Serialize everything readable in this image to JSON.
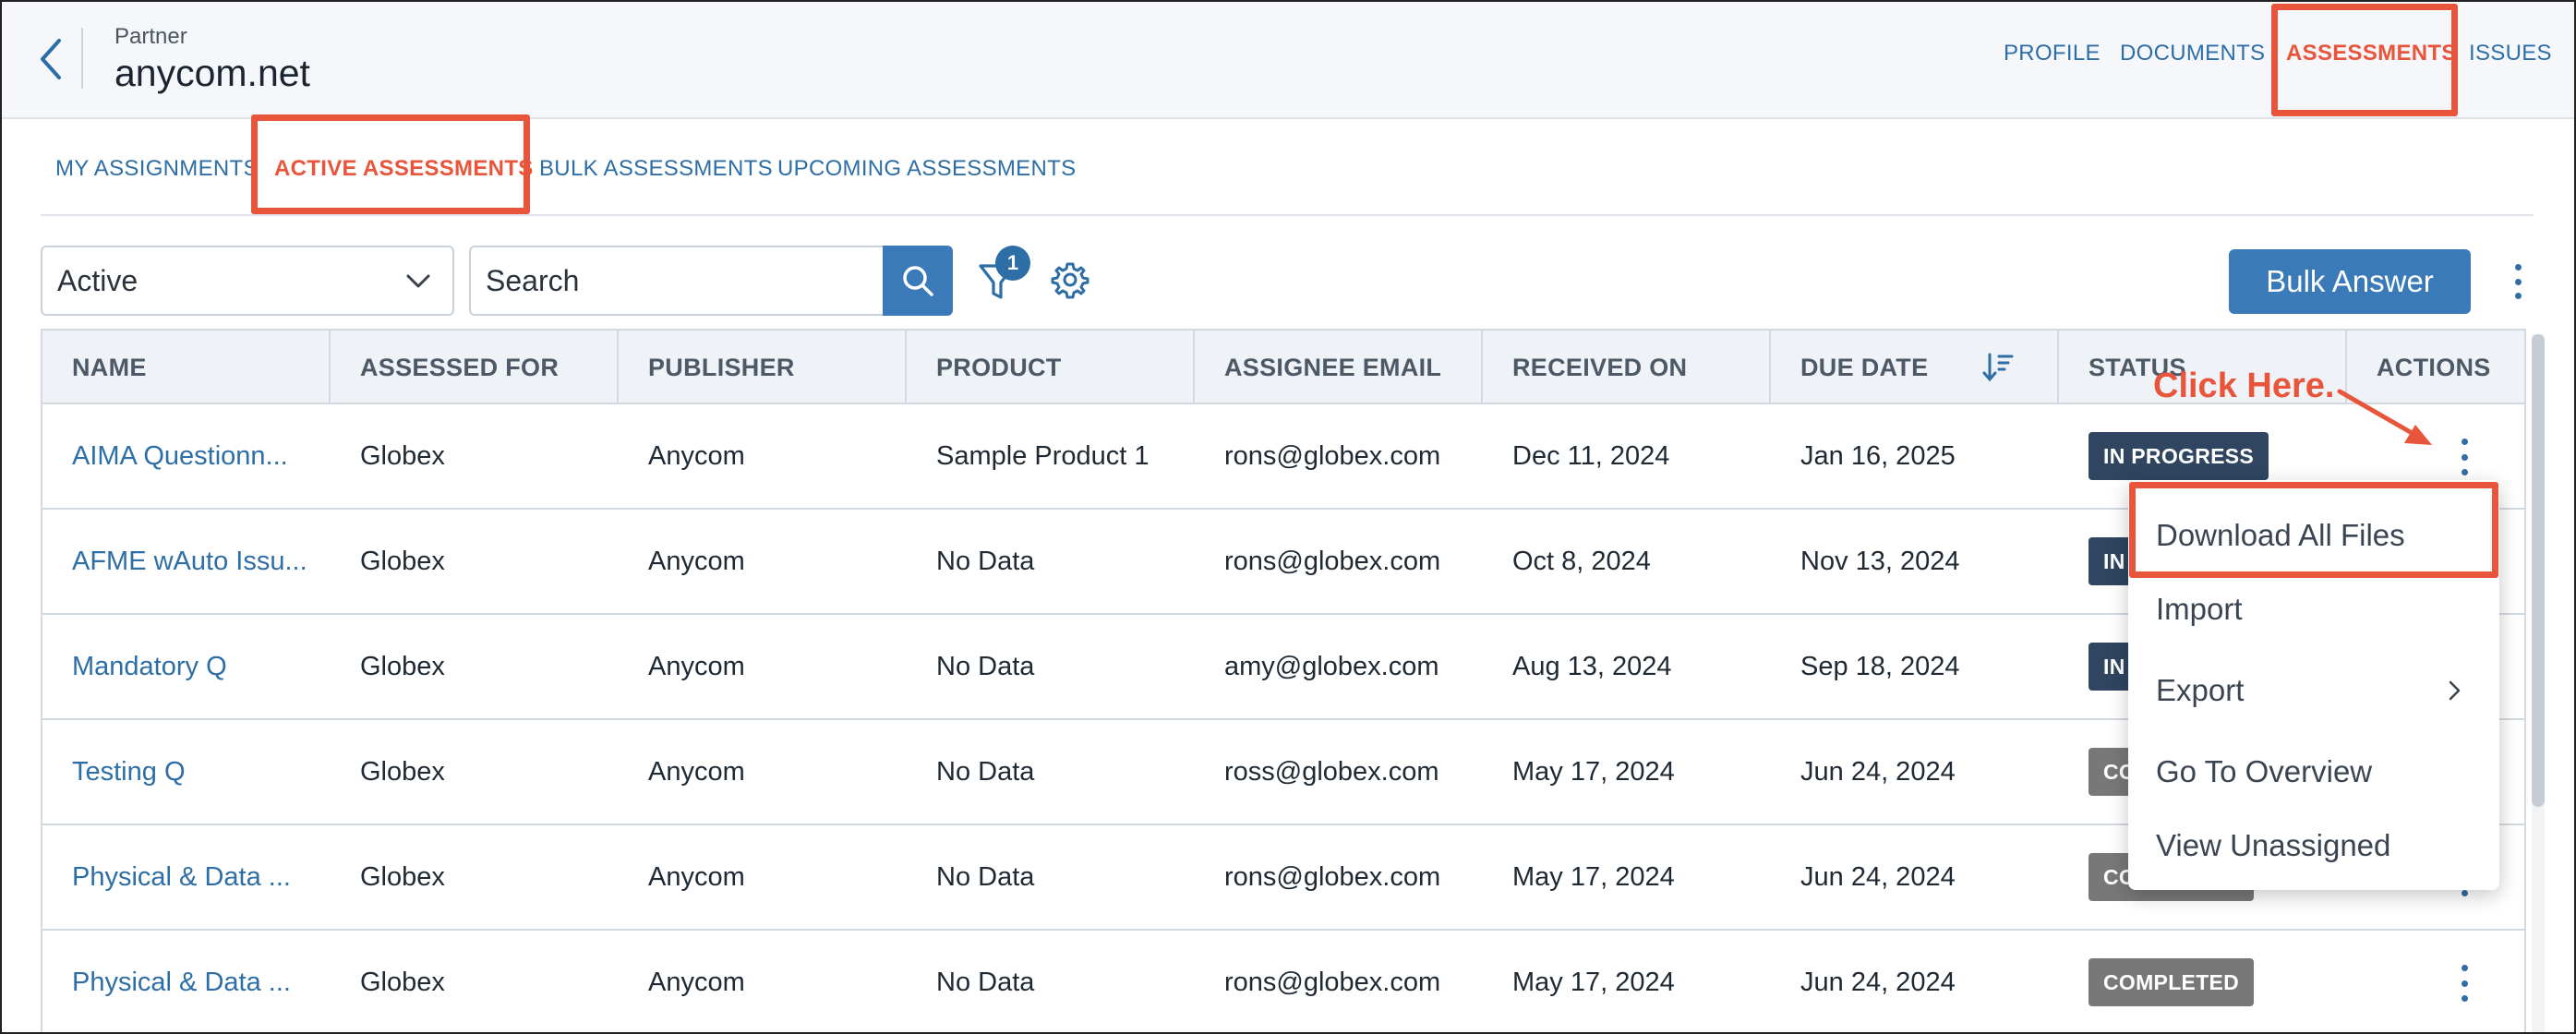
{
  "header": {
    "partner_label": "Partner",
    "partner_name": "anycom.net",
    "nav": [
      "PROFILE",
      "DOCUMENTS",
      "ASSESSMENTS",
      "ISSUES"
    ]
  },
  "subtabs": [
    "MY ASSIGNMENTS",
    "ACTIVE ASSESSMENTS",
    "BULK ASSESSMENTS",
    "UPCOMING ASSESSMENTS"
  ],
  "toolbar": {
    "status_value": "Active",
    "search_placeholder": "Search",
    "filter_count": "1",
    "bulk_answer_label": "Bulk Answer"
  },
  "table": {
    "columns": [
      "NAME",
      "ASSESSED FOR",
      "PUBLISHER",
      "PRODUCT",
      "ASSIGNEE EMAIL",
      "RECEIVED ON",
      "DUE DATE",
      "STATUS",
      "ACTIONS"
    ],
    "rows": [
      {
        "name": "AIMA Questionn...",
        "assessed_for": "Globex",
        "publisher": "Anycom",
        "product": "Sample Product 1",
        "email": "rons@globex.com",
        "received": "Dec 11, 2024",
        "due": "Jan 16, 2025",
        "status": "IN PROGRESS"
      },
      {
        "name": "AFME wAuto Issu...",
        "assessed_for": "Globex",
        "publisher": "Anycom",
        "product": "No Data",
        "email": "rons@globex.com",
        "received": "Oct 8, 2024",
        "due": "Nov 13, 2024",
        "status": "IN PROGRESS"
      },
      {
        "name": "Mandatory Q",
        "assessed_for": "Globex",
        "publisher": "Anycom",
        "product": "No Data",
        "email": "amy@globex.com",
        "received": "Aug 13, 2024",
        "due": "Sep 18, 2024",
        "status": "IN PROGRESS"
      },
      {
        "name": "Testing Q",
        "assessed_for": "Globex",
        "publisher": "Anycom",
        "product": "No Data",
        "email": "ross@globex.com",
        "received": "May 17, 2024",
        "due": "Jun 24, 2024",
        "status": "COMPLETED"
      },
      {
        "name": "Physical & Data ...",
        "assessed_for": "Globex",
        "publisher": "Anycom",
        "product": "No Data",
        "email": "rons@globex.com",
        "received": "May 17, 2024",
        "due": "Jun 24, 2024",
        "status": "COMPLETED"
      },
      {
        "name": "Physical & Data ...",
        "assessed_for": "Globex",
        "publisher": "Anycom",
        "product": "No Data",
        "email": "rons@globex.com",
        "received": "May 17, 2024",
        "due": "Jun 24, 2024",
        "status": "COMPLETED"
      }
    ]
  },
  "actions_menu": {
    "items": [
      "Download All Files",
      "Import",
      "Export",
      "Go To Overview",
      "View Unassigned"
    ]
  },
  "annotation": {
    "text": "Click Here."
  },
  "colors": {
    "accent": "#3a7ab8",
    "link": "#2e6ea6",
    "highlight": "#e8553a",
    "in_progress": "#2f4560",
    "completed": "#787878"
  }
}
